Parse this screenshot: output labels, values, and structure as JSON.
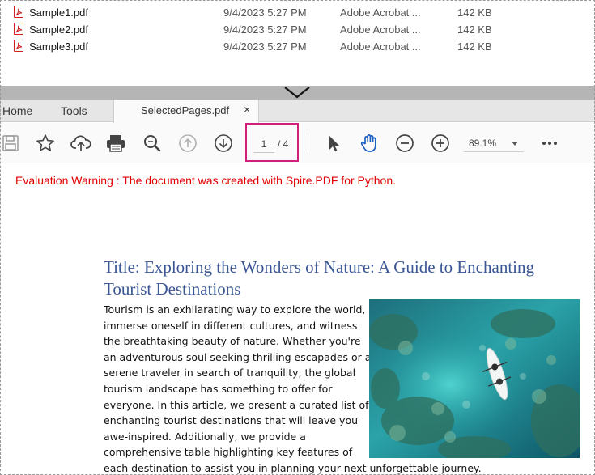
{
  "files": [
    {
      "name": "Sample1.pdf",
      "date": "9/4/2023 5:27 PM",
      "type": "Adobe Acrobat ...",
      "size": "142 KB"
    },
    {
      "name": "Sample2.pdf",
      "date": "9/4/2023 5:27 PM",
      "type": "Adobe Acrobat ...",
      "size": "142 KB"
    },
    {
      "name": "Sample3.pdf",
      "date": "9/4/2023 5:27 PM",
      "type": "Adobe Acrobat ...",
      "size": "142 KB"
    }
  ],
  "tabs": {
    "home": "Home",
    "tools": "Tools",
    "active": "SelectedPages.pdf",
    "close": "×"
  },
  "toolbar": {
    "icons": [
      "save-icon",
      "star-icon",
      "cloud-upload-icon",
      "print-icon",
      "zoom-search-icon",
      "page-up-icon",
      "page-down-icon",
      "select-cursor-icon",
      "hand-tool-icon",
      "zoom-out-icon",
      "zoom-in-icon",
      "more-icon"
    ],
    "page_current": "1",
    "page_total": "/ 4",
    "zoom": "89.1%"
  },
  "document": {
    "warning": "Evaluation Warning : The document was created with Spire.PDF for Python.",
    "title": "Title: Exploring the Wonders of Nature: A Guide to Enchanting Tourist Destinations",
    "body_lines": [
      "Tourism is an exhilarating way to explore the world,",
      "immerse oneself in different cultures, and witness",
      "the breathtaking beauty of nature. Whether you're",
      "an adventurous soul seeking thrilling escapades or a",
      "serene traveler in search of tranquility, the global",
      "tourism landscape has something to offer for",
      "everyone. In this article, we present a curated list of",
      "enchanting tourist destinations that will leave you",
      "awe-inspired. Additionally, we provide a",
      "comprehensive table highlighting key features of",
      "each destination to assist you in planning your next unforgettable journey."
    ]
  },
  "colors": {
    "pdf_red": "#d21e1e",
    "title_blue": "#3a5694",
    "warning_red": "#e00000",
    "page_highlight": "#d01f7a",
    "divider_gray": "#b5b5b5"
  }
}
